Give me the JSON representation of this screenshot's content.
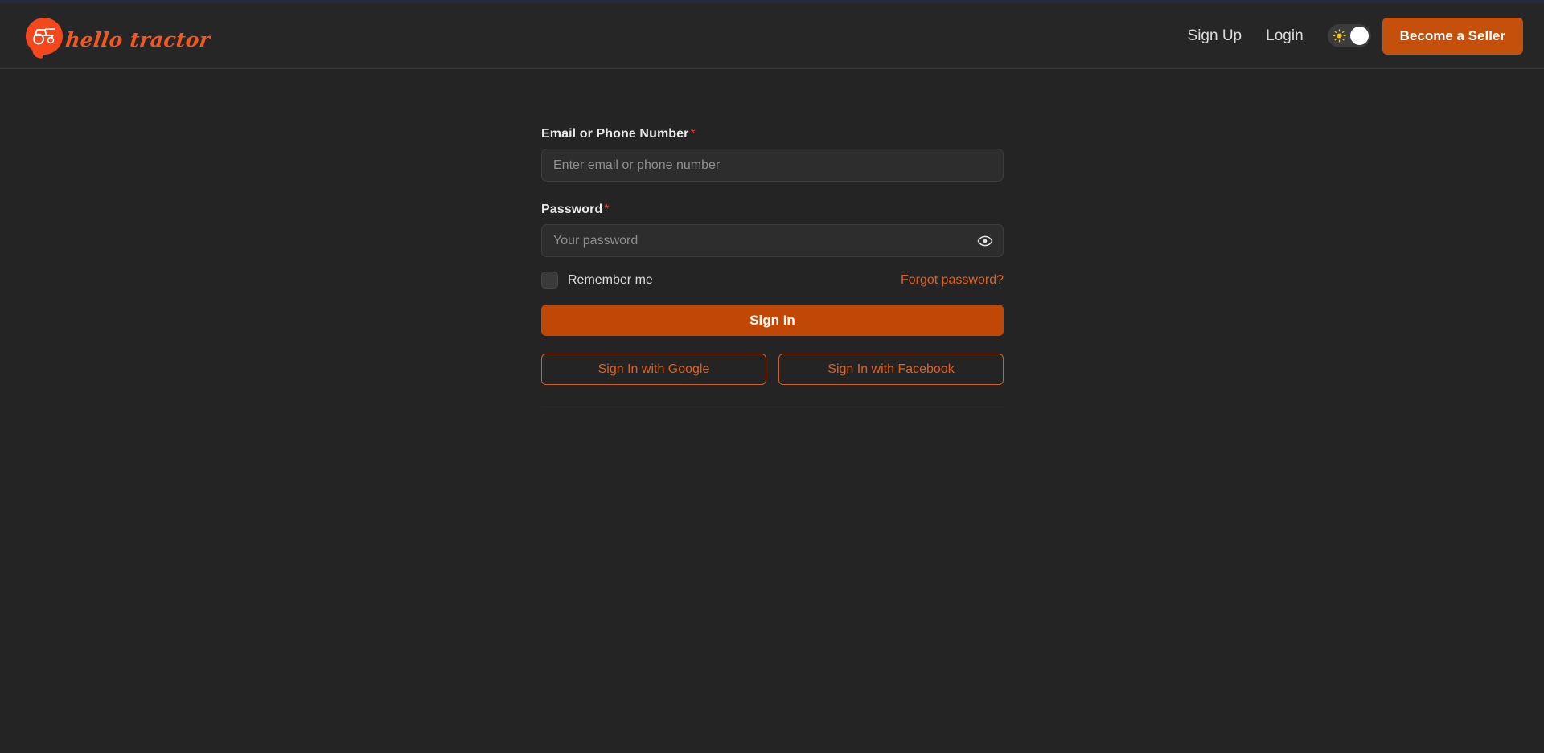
{
  "brand": {
    "logo_icon": "tractor-speech-bubble-icon",
    "wordmark": "hello tractor"
  },
  "header": {
    "nav": [
      {
        "label": "Sign Up",
        "name": "sign-up-link"
      },
      {
        "label": "Login",
        "name": "login-link"
      }
    ],
    "theme_toggle": {
      "icon": "sun-icon",
      "state": "light",
      "track_color": "#3c3c3c",
      "knob_color": "#ffffff",
      "sun_color": "#F2C014"
    },
    "seller_button": {
      "label": "Become a Seller",
      "color": "#C4500B",
      "text_color": "#ffffff"
    }
  },
  "form": {
    "email": {
      "label": "Email or Phone Number",
      "required_mark": "*",
      "placeholder": "Enter email or phone number",
      "value": ""
    },
    "password": {
      "label": "Password",
      "required_mark": "*",
      "placeholder": "Your password",
      "value": "",
      "toggle_icon": "eye-icon"
    },
    "remember": {
      "label": "Remember me",
      "checked": false
    },
    "forgot_link": "Forgot password?",
    "submit_button": "Sign In",
    "social": [
      {
        "label": "Sign In with Google",
        "name": "sign-in-google-button"
      },
      {
        "label": "Sign In with Facebook",
        "name": "sign-in-facebook-button"
      }
    ]
  },
  "colors": {
    "page_background": "#242424",
    "header_background": "#262626",
    "accent_orange": "#C04706",
    "link_orange": "#E0601F",
    "brand_orange": "#F4471C",
    "required_red": "#d83838",
    "input_background": "#2d2d2d"
  }
}
